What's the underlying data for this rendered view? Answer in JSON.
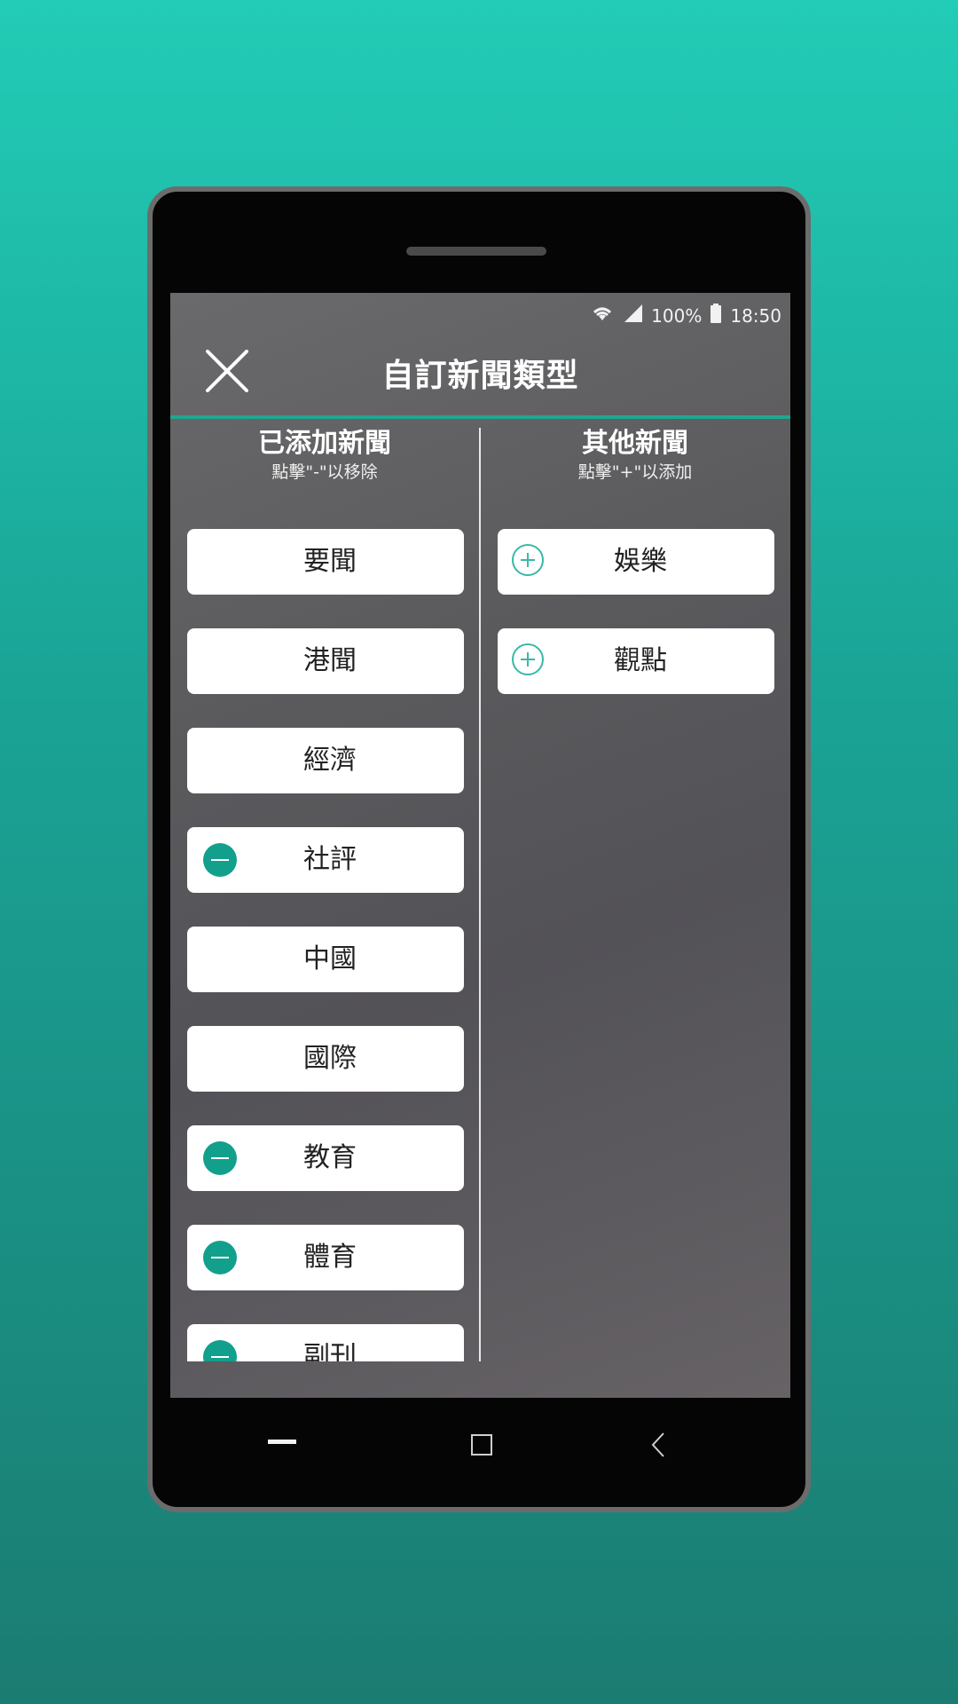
{
  "status": {
    "battery": "100%",
    "time": "18:50",
    "icons": [
      "wifi-icon",
      "signal-icon",
      "battery-icon"
    ]
  },
  "appbar": {
    "title": "自訂新聞類型",
    "close_icon": "close-icon"
  },
  "added": {
    "heading": "已添加新聞",
    "hint": "點擊\"-\"以移除",
    "items": [
      {
        "label": "要聞",
        "removable": false
      },
      {
        "label": "港聞",
        "removable": false
      },
      {
        "label": "經濟",
        "removable": false
      },
      {
        "label": "社評",
        "removable": true
      },
      {
        "label": "中國",
        "removable": false
      },
      {
        "label": "國際",
        "removable": false
      },
      {
        "label": "教育",
        "removable": true
      },
      {
        "label": "體育",
        "removable": true
      },
      {
        "label": "副刊",
        "removable": true
      }
    ]
  },
  "other": {
    "heading": "其他新聞",
    "hint": "點擊\"+\"以添加",
    "items": [
      {
        "label": "娛樂"
      },
      {
        "label": "觀點"
      }
    ]
  },
  "colors": {
    "accent": "#12a08c",
    "background_top": "#22ccb6",
    "background_bottom": "#1b7c72"
  },
  "nav": {
    "icons": [
      "recents-icon",
      "home-icon",
      "back-icon"
    ]
  }
}
